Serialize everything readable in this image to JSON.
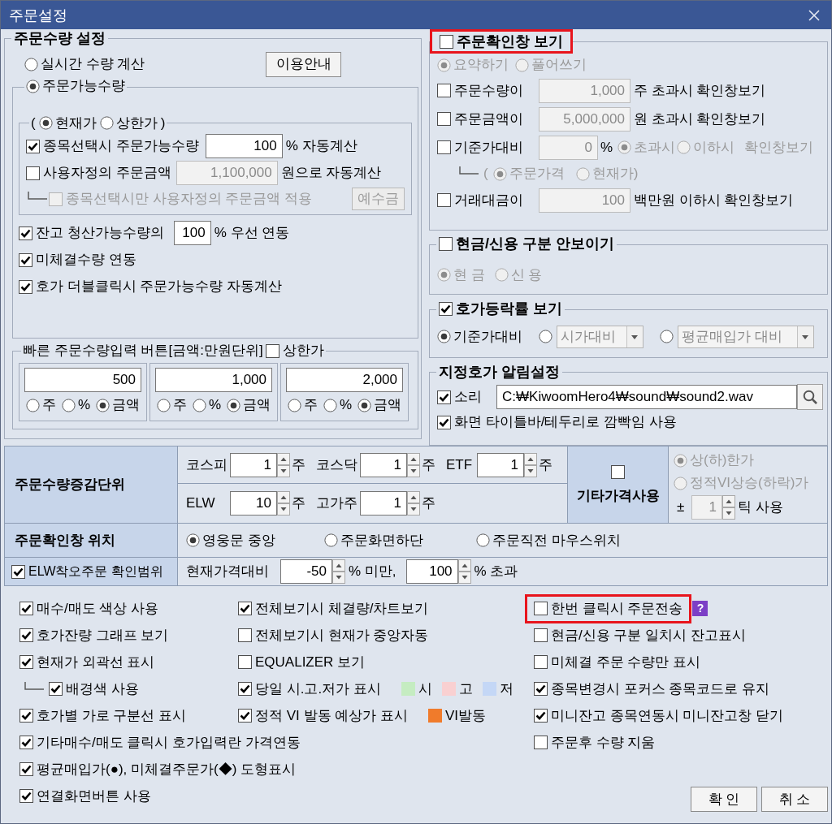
{
  "window": {
    "title": "주문설정"
  },
  "order_quantity": {
    "title": "주문수량 설정",
    "modes": [
      {
        "label": "실시간 수량 계산",
        "selected": false
      },
      {
        "label": "주문가능수량",
        "selected": true
      }
    ],
    "guide_button": "이용안내",
    "price_basis": {
      "open": "(",
      "options": [
        {
          "label": "현재가",
          "selected": true
        },
        {
          "label": "상한가",
          "selected": false
        }
      ],
      "close": ")"
    },
    "auto_calc": [
      {
        "checked": true,
        "label": "종목선택시 주문가능수량",
        "value": "100",
        "suffix": "% 자동계산"
      },
      {
        "checked": false,
        "label": "사용자정의 주문금액",
        "value": "1,100,000",
        "suffix": "원으로 자동계산",
        "children": [
          {
            "checked": false,
            "label": "종목선택시만 사용자정의 주문금액 적용",
            "button": "예수금"
          }
        ]
      }
    ],
    "links": [
      {
        "checked": true,
        "label": "잔고 청산가능수량의",
        "value": "100",
        "suffix": "% 우선 연동"
      },
      {
        "checked": true,
        "label": "미체결수량 연동"
      },
      {
        "checked": true,
        "label": "호가 더블클릭시 주문가능수량 자동계산"
      }
    ]
  },
  "quick_buttons": {
    "title": "빠른 주문수량입력 버튼[금액:만원단위]",
    "upper_limit": {
      "checked": false,
      "label": "상한가"
    },
    "slots": [
      {
        "value": "500",
        "units": [
          {
            "label": "주",
            "selected": false
          },
          {
            "label": "%",
            "selected": false
          },
          {
            "label": "금액",
            "selected": true
          }
        ]
      },
      {
        "value": "1,000",
        "units": [
          {
            "label": "주",
            "selected": false
          },
          {
            "label": "%",
            "selected": false
          },
          {
            "label": "금액",
            "selected": true
          }
        ]
      },
      {
        "value": "2,000",
        "units": [
          {
            "label": "주",
            "selected": false
          },
          {
            "label": "%",
            "selected": false
          },
          {
            "label": "금액",
            "selected": true
          }
        ]
      }
    ]
  },
  "order_confirm": {
    "title": "주문확인창 보기",
    "checked": false,
    "highlighted": true,
    "styles": [
      {
        "label": "요약하기",
        "selected": true
      },
      {
        "label": "풀어쓰기",
        "selected": false
      }
    ],
    "rules": [
      {
        "kind": "threshold",
        "checked": false,
        "label": "주문수량이",
        "value": "1,000",
        "suffix": "주 초과시 확인창보기"
      },
      {
        "kind": "threshold",
        "checked": false,
        "label": "주문금액이",
        "value": "5,000,000",
        "suffix": "원 초과시 확인창보기"
      },
      {
        "kind": "compare",
        "checked": false,
        "label": "기준가대비",
        "value": "0",
        "unit": "%",
        "options": [
          {
            "label": "초과시",
            "selected": true
          },
          {
            "label": "이하시",
            "selected": false
          }
        ],
        "suffix": "확인창보기",
        "children": [
          {
            "open": "(",
            "options": [
              {
                "label": "주문가격",
                "selected": true
              },
              {
                "label": "현재가",
                "selected": false
              }
            ],
            "close": ")"
          }
        ]
      },
      {
        "kind": "threshold",
        "checked": false,
        "label": "거래대금이",
        "value": "100",
        "suffix": "백만원 이하시 확인창보기"
      }
    ]
  },
  "cash_credit": {
    "title": "현금/신용 구분 안보이기",
    "checked": false,
    "disabled": true,
    "options": [
      {
        "label": "현 금",
        "selected": true
      },
      {
        "label": "신 용",
        "selected": false
      }
    ]
  },
  "change_rate": {
    "title": "호가등락률 보기",
    "checked": true,
    "options": [
      {
        "kind": "label",
        "label": "기준가대비",
        "selected": true
      },
      {
        "kind": "dropdown",
        "value": "시가대비",
        "selected": false
      },
      {
        "kind": "dropdown",
        "value": "평균매입가 대비",
        "selected": false
      }
    ]
  },
  "price_alert": {
    "title": "지정호가 알림설정",
    "sound": {
      "checked": true,
      "label": "소리",
      "path": "C:₩KiwoomHero4₩sound₩sound2.wav"
    },
    "blink": {
      "checked": true,
      "label": "화면 타이틀바/테두리로 깜빡임 사용"
    }
  },
  "order_table": {
    "increment": {
      "header": "주문수량증감단위",
      "lines": [
        {
          "fields": [
            {
              "label": "코스피",
              "value": "1",
              "unit": "주"
            },
            {
              "label": "코스닥",
              "value": "1",
              "unit": "주"
            },
            {
              "label": "ETF",
              "value": "1",
              "unit": "주"
            }
          ]
        },
        {
          "fields": [
            {
              "label": "ELW",
              "value": "10",
              "unit": "주"
            },
            {
              "label": "고가주",
              "value": "1",
              "unit": "주"
            }
          ]
        }
      ]
    },
    "other_price": {
      "label": "기타가격사용",
      "checked": false,
      "options": [
        {
          "label": "상(하)한가",
          "selected": true
        },
        {
          "label": "정적VI상승(하락)가",
          "selected": false
        }
      ],
      "tick": {
        "sign": "±",
        "value": "1",
        "suffix": "틱 사용"
      }
    },
    "confirm_position": {
      "header": "주문확인창 위치",
      "options": [
        {
          "label": "영웅문 중앙",
          "selected": true
        },
        {
          "label": "주문화면하단",
          "selected": false
        },
        {
          "label": "주문직전 마우스위치",
          "selected": false
        }
      ]
    },
    "elw_range": {
      "header": "ELW착오주문 확인범위",
      "checked": true,
      "label": "현재가격대비",
      "low": "-50",
      "low_suffix": "% 미만,",
      "high": "100",
      "high_suffix": "% 초과"
    }
  },
  "display_options": {
    "columns": [
      {
        "items": [
          {
            "checked": true,
            "label": "매수/매도 색상 사용"
          },
          {
            "checked": true,
            "label": "호가잔량 그래프 보기"
          },
          {
            "checked": true,
            "label": "현재가 외곽선 표시",
            "children": [
              {
                "checked": true,
                "label": "배경색 사용"
              }
            ]
          },
          {
            "checked": true,
            "label": "호가별 가로 구분선 표시"
          },
          {
            "checked": true,
            "label": "기타매수/매도 클릭시 호가입력란 가격연동"
          },
          {
            "checked": true,
            "label": "평균매입가(●), 미체결주문가(◆) 도형표시"
          },
          {
            "checked": true,
            "label": "연결화면버튼 사용"
          }
        ]
      },
      {
        "items": [
          {
            "checked": true,
            "label": "전체보기시 체결량/차트보기"
          },
          {
            "checked": false,
            "label": "전체보기시 현재가 중앙자동"
          },
          {
            "checked": false,
            "label": "EQUALIZER 보기"
          },
          {
            "checked": true,
            "label": "당일 시.고.저가 표시",
            "swatches": [
              {
                "label": "시",
                "color": "#c5ecc1"
              },
              {
                "label": "고",
                "color": "#f9d0d1"
              },
              {
                "label": "저",
                "color": "#c4d7f6"
              }
            ]
          },
          {
            "checked": true,
            "label": "정적 VI 발동 예상가 표시",
            "swatches": [
              {
                "label": "VI발동",
                "color": "#f07b2b"
              }
            ]
          }
        ]
      },
      {
        "items": [
          {
            "checked": false,
            "label": "한번 클릭시 주문전송",
            "highlighted": true,
            "help": "?"
          },
          {
            "checked": false,
            "label": "현금/신용 구분 일치시 잔고표시"
          },
          {
            "checked": false,
            "label": "미체결 주문 수량만 표시"
          },
          {
            "checked": true,
            "label": "종목변경시 포커스 종목코드로 유지"
          },
          {
            "checked": true,
            "label": "미니잔고 종목연동시 미니잔고창 닫기"
          },
          {
            "checked": false,
            "label": "주문후 수량 지움"
          }
        ]
      }
    ]
  },
  "buttons": [
    "확 인",
    "취 소"
  ]
}
